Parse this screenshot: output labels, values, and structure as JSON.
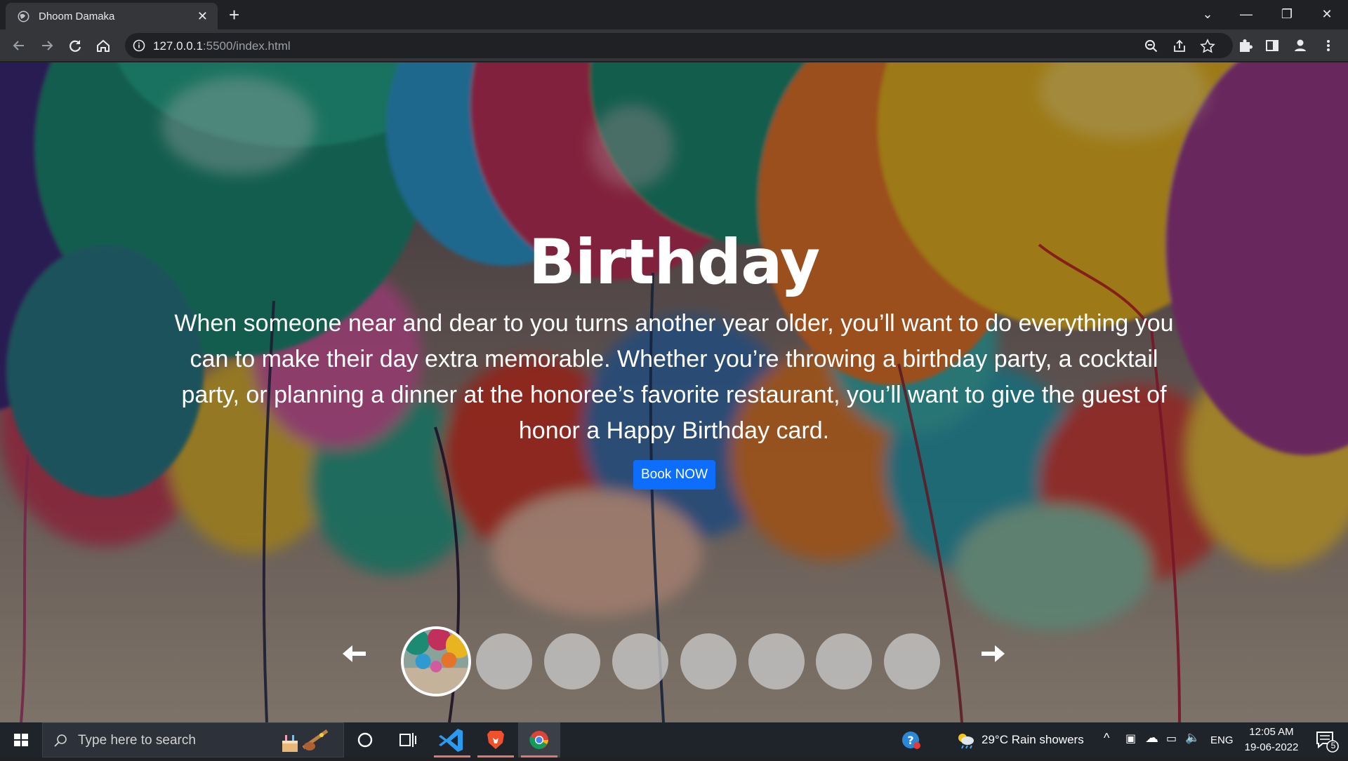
{
  "browser": {
    "tab_title": "Dhoom Damaka",
    "url_host": "127.0.0.1",
    "url_path": ":5500/index.html"
  },
  "hero": {
    "title": "Birthday",
    "description": "When someone near and dear to you turns another year older, you’ll want to do everything you can to make their day extra memorable. Whether you’re throwing a birthday party, a cocktail party, or planning a dinner at the honoree’s favorite restaurant, you’ll want to give the guest of honor a Happy Birthday card.",
    "button_label": "Book NOW"
  },
  "carousel": {
    "prev_icon": "arrow-left-icon",
    "next_icon": "arrow-right-icon",
    "thumb_count": 8,
    "active_index": 0
  },
  "taskbar": {
    "search_placeholder": "Type here to search",
    "weather": "29°C  Rain showers",
    "language": "ENG",
    "time": "12:05 AM",
    "date": "19-06-2022",
    "notifications": "5"
  },
  "colors": {
    "accent": "#0d6efd",
    "chrome_dark": "#202124",
    "chrome_toolbar": "#35363a",
    "taskbar": "#1f232a"
  }
}
